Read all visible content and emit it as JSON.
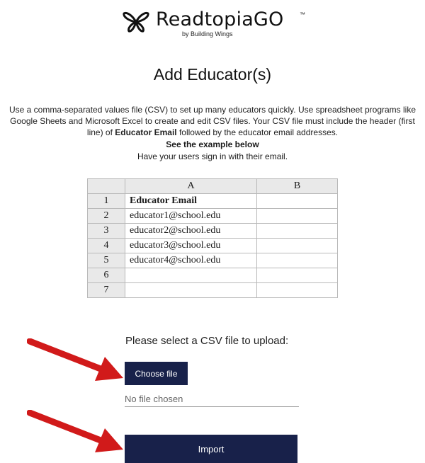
{
  "brand": {
    "name": "ReadtopiaGO",
    "trademark": "™",
    "tagline": "by Building Wings"
  },
  "page": {
    "title": "Add Educator(s)"
  },
  "instructions": {
    "part1": "Use a comma-separated values file (CSV) to set up many educators quickly. Use spreadsheet programs like Google Sheets and Microsoft Excel to create and edit CSV files. Your CSV file must include the header (first line) of ",
    "bold": "Educator Email",
    "part2": " followed by the educator email addresses.",
    "example_note": "See the example below",
    "signin_note": "Have your users sign in with their email."
  },
  "sheet": {
    "columns": [
      "A",
      "B"
    ],
    "rows": [
      {
        "n": "1",
        "a": "Educator Email",
        "b": ""
      },
      {
        "n": "2",
        "a": "educator1@school.edu",
        "b": ""
      },
      {
        "n": "3",
        "a": "educator2@school.edu",
        "b": ""
      },
      {
        "n": "4",
        "a": "educator3@school.edu",
        "b": ""
      },
      {
        "n": "5",
        "a": "educator4@school.edu",
        "b": ""
      },
      {
        "n": "6",
        "a": "",
        "b": ""
      },
      {
        "n": "7",
        "a": "",
        "b": ""
      }
    ]
  },
  "upload": {
    "label": "Please select a CSV file to upload:",
    "choose_button": "Choose file",
    "file_status": "No file chosen",
    "import_button": "Import"
  },
  "colors": {
    "button_bg": "#18214a",
    "arrow": "#d11a1a"
  }
}
